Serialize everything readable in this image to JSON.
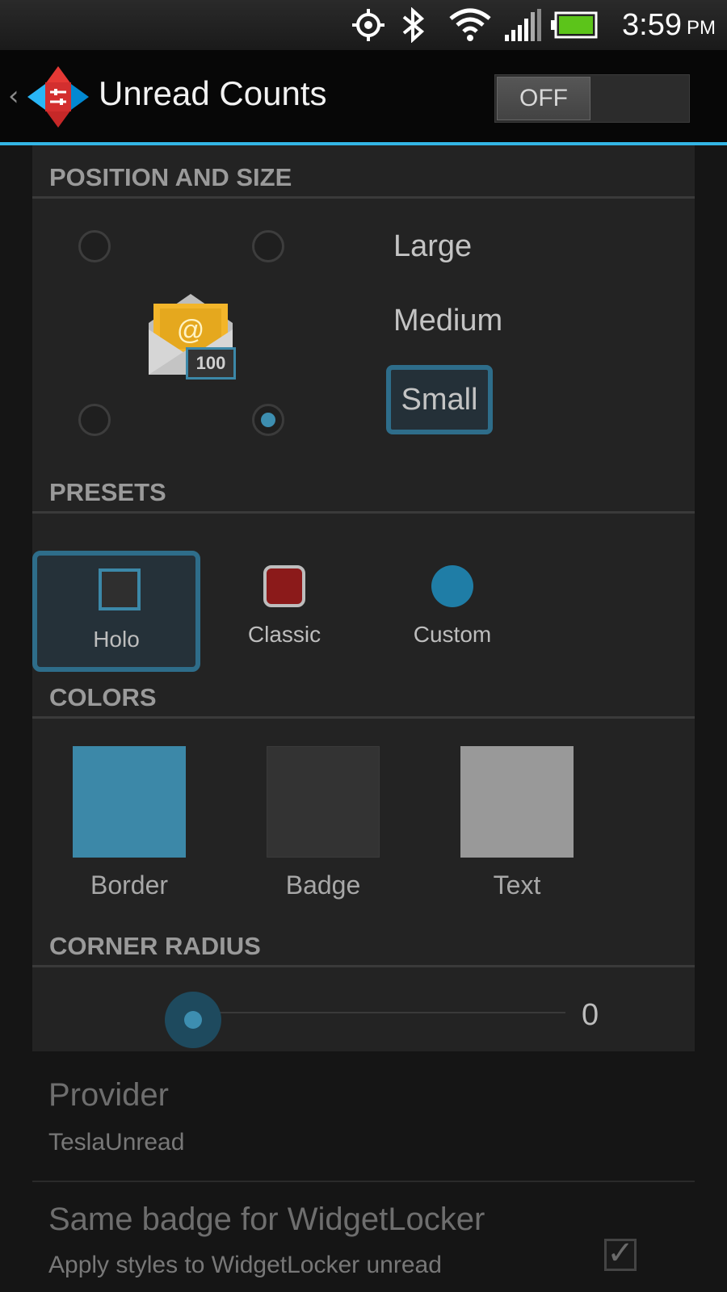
{
  "status_bar": {
    "time": "3:59",
    "ampm": "PM",
    "icons": [
      "gps-icon",
      "bluetooth-icon",
      "wifi-icon",
      "signal-icon",
      "battery-icon"
    ]
  },
  "action_bar": {
    "title": "Unread Counts",
    "toggle_label": "OFF"
  },
  "position_and_size": {
    "header": "POSITION AND SIZE",
    "sizes": [
      "Large",
      "Medium",
      "Small"
    ],
    "selected_size": "Small",
    "selected_position": "bottom-right",
    "preview_badge": "100"
  },
  "presets": {
    "header": "PRESETS",
    "items": [
      "Holo",
      "Classic",
      "Custom"
    ],
    "selected": "Holo"
  },
  "colors": {
    "header": "COLORS",
    "items": [
      {
        "label": "Border",
        "color": "#3c88a8"
      },
      {
        "label": "Badge",
        "color": "#333333"
      },
      {
        "label": "Text",
        "color": "#999999"
      }
    ]
  },
  "corner_radius": {
    "header": "CORNER RADIUS",
    "value": "0"
  },
  "provider": {
    "title": "Provider",
    "summary": "TeslaUnread"
  },
  "widgetlocker": {
    "title": "Same badge for WidgetLocker",
    "summary": "Apply styles to WidgetLocker unread"
  },
  "theme": {
    "accent": "#33b5e5",
    "selection": "#2e6d8a"
  }
}
